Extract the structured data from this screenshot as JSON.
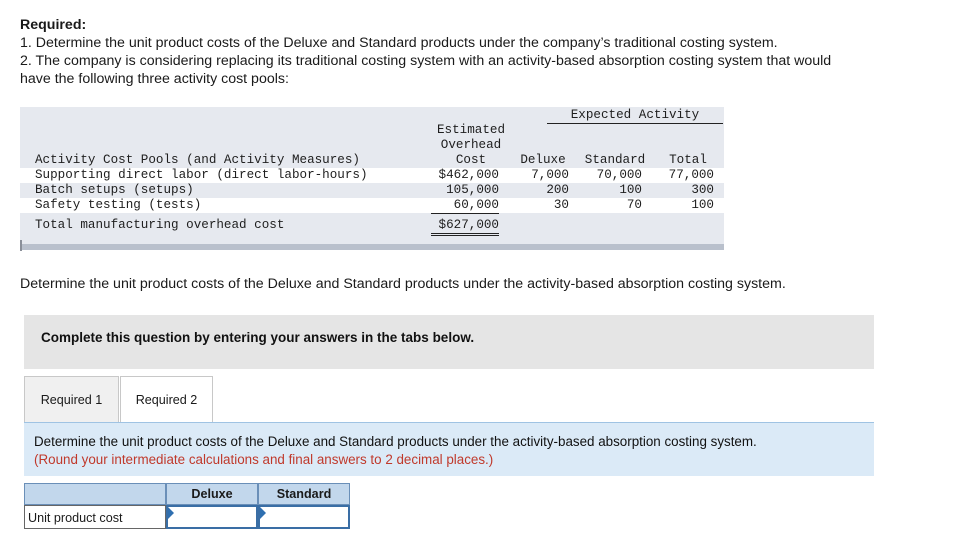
{
  "required": {
    "title": "Required:",
    "line1": "1. Determine the unit product costs of the Deluxe and Standard products under the company’s traditional costing system.",
    "line2a": "2. The company is considering replacing its traditional costing system with an activity-based absorption costing system that would",
    "line2b": "have the following three activity cost pools:"
  },
  "activity_table": {
    "header_estimated": [
      "Estimated",
      "Overhead",
      "Cost"
    ],
    "header_expected": "Expected Activity",
    "col_pools": "Activity Cost Pools (and Activity Measures)",
    "col_deluxe": "Deluxe",
    "col_standard": "Standard",
    "col_total": "Total",
    "rows": [
      {
        "pool": "Supporting direct labor (direct labor-hours)",
        "cost": "$462,000",
        "deluxe": "7,000",
        "standard": "70,000",
        "total": "77,000"
      },
      {
        "pool": "Batch setups (setups)",
        "cost": "105,000",
        "deluxe": "200",
        "standard": "100",
        "total": "300"
      },
      {
        "pool": "Safety testing (tests)",
        "cost": "60,000",
        "deluxe": "30",
        "standard": "70",
        "total": "100"
      }
    ],
    "total_label": "Total manufacturing overhead cost",
    "total_cost": "$627,000"
  },
  "question": "Determine the unit product costs of the Deluxe and Standard products under the activity-based absorption costing system.",
  "complete_prompt": "Complete this question by entering your answers in the tabs below.",
  "tabs": [
    {
      "label": "Required 1",
      "active": false
    },
    {
      "label": "Required 2",
      "active": true
    }
  ],
  "instructions": {
    "main": "Determine the unit product costs of the Deluxe and Standard products under the activity-based absorption costing system.",
    "note": "(Round your intermediate calculations and final answers to 2 decimal places.)"
  },
  "answer_table": {
    "col_deluxe": "Deluxe",
    "col_standard": "Standard",
    "row_label": "Unit product cost",
    "deluxe_value": "",
    "standard_value": ""
  },
  "colors": {
    "table_bg": "#e6e9ef",
    "instr_bg": "#dbeaf7",
    "note_red": "#c0392b",
    "header_blue": "#c2d7ec"
  }
}
